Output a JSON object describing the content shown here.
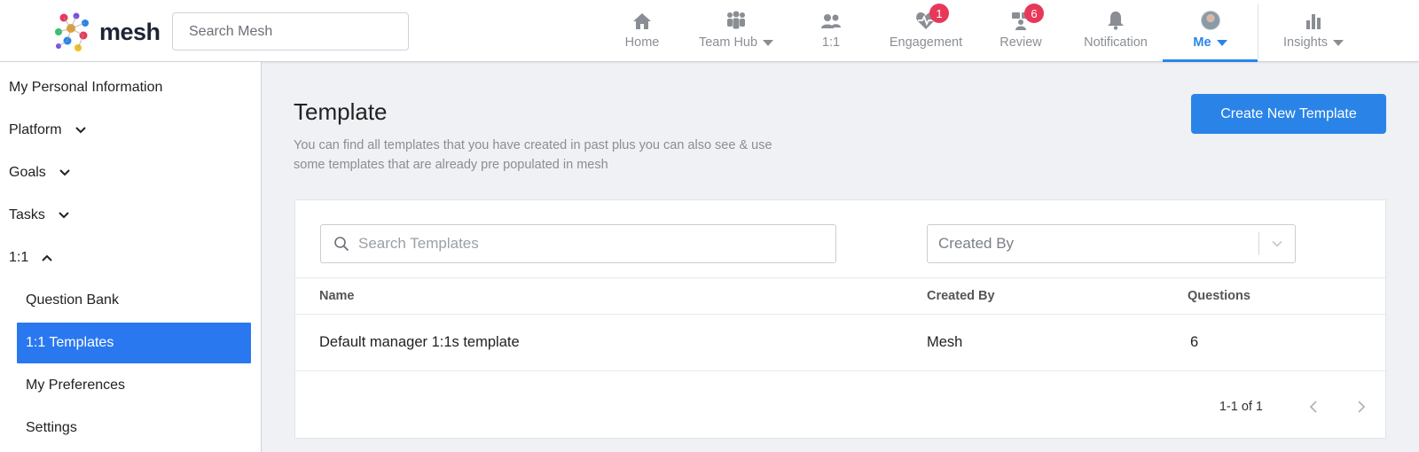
{
  "header": {
    "logo_text": "mesh",
    "search_placeholder": "Search Mesh",
    "nav": [
      {
        "label": "Home",
        "icon": "home-icon"
      },
      {
        "label": "Team Hub",
        "icon": "team-icon"
      },
      {
        "label": "1:1",
        "icon": "people-icon"
      },
      {
        "label": "Engagement",
        "icon": "heart-pulse-icon",
        "badge": "1"
      },
      {
        "label": "Review",
        "icon": "review-icon",
        "badge": "6"
      },
      {
        "label": "Notification",
        "icon": "bell-icon"
      },
      {
        "label": "Me",
        "icon": "avatar"
      },
      {
        "label": "Insights",
        "icon": "bar-chart-icon"
      }
    ],
    "accent_color": "#2a84e8",
    "badge_color": "#e8385a"
  },
  "sidebar": {
    "items": [
      {
        "label": "My Personal Information"
      },
      {
        "label": "Platform"
      },
      {
        "label": "Goals"
      },
      {
        "label": "Tasks"
      },
      {
        "label": "1:1"
      },
      {
        "label": "Question Bank"
      },
      {
        "label": "1:1 Templates"
      },
      {
        "label": "My Preferences"
      },
      {
        "label": "Settings"
      }
    ]
  },
  "main": {
    "title": "Template",
    "description": "You can find all templates that you have created in past plus you can also see & use some templates that are already pre populated in mesh",
    "create_button": "Create New Template",
    "search_placeholder": "Search Templates",
    "filter_value": "Created By",
    "columns": [
      "Name",
      "Created By",
      "Questions"
    ],
    "rows": [
      {
        "name": "Default manager 1:1s template",
        "created_by": "Mesh",
        "questions": "6"
      }
    ],
    "pagination": "1-1 of 1"
  }
}
